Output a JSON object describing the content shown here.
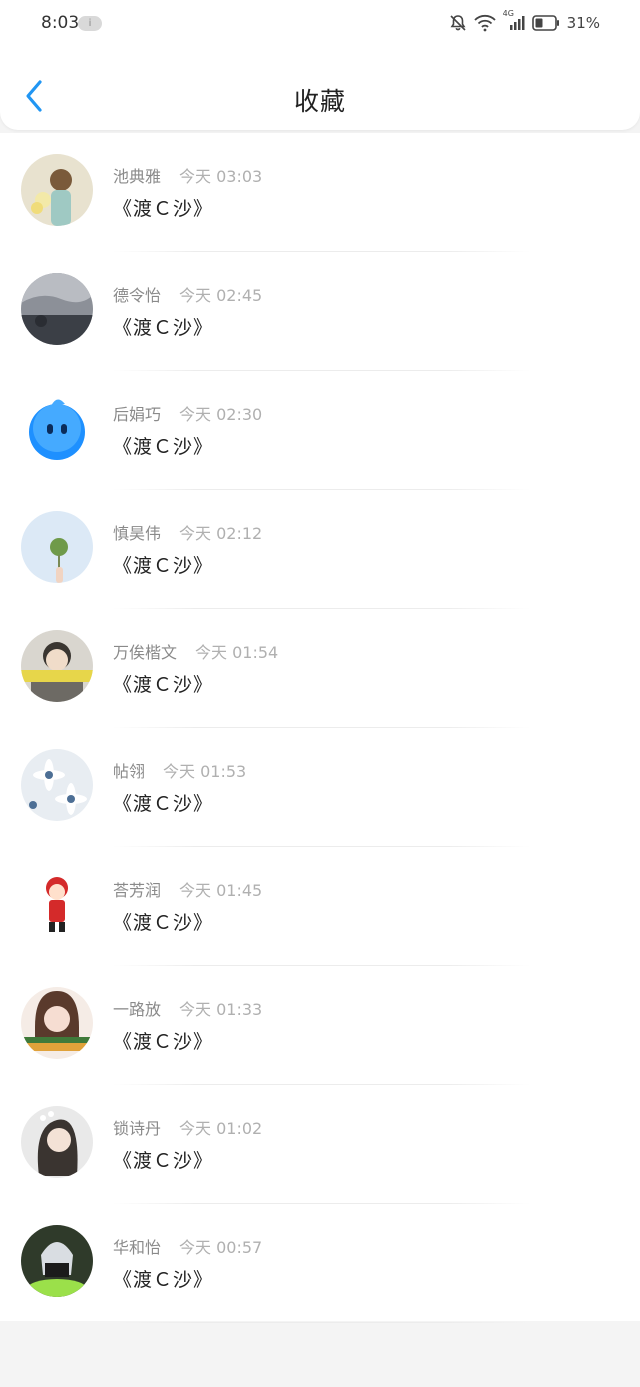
{
  "status_bar": {
    "time": "8:03",
    "pill_label": "i",
    "battery_text": "31%",
    "network_label": "4G",
    "icons": [
      "bell-off-icon",
      "wifi-icon",
      "signal-icon",
      "battery-icon"
    ]
  },
  "header": {
    "title": "收藏",
    "back_icon": "chevron-left-icon"
  },
  "items": [
    {
      "name": "池典雅",
      "time": "今天 03:03",
      "title": "《渡Ｃ沙》",
      "avatar_colors": [
        "#e8e2cf",
        "#c9b58a"
      ]
    },
    {
      "name": "德令怡",
      "time": "今天 02:45",
      "title": "《渡Ｃ沙》",
      "avatar_colors": [
        "#8c9098",
        "#3b3f46"
      ]
    },
    {
      "name": "后娟巧",
      "time": "今天 02:30",
      "title": "《渡Ｃ沙》",
      "avatar_colors": [
        "#ffffff",
        "#1e90ff"
      ]
    },
    {
      "name": "慎昊伟",
      "time": "今天 02:12",
      "title": "《渡Ｃ沙》",
      "avatar_colors": [
        "#dce9f6",
        "#b8cfe8"
      ]
    },
    {
      "name": "万俟楷文",
      "time": "今天 01:54",
      "title": "《渡Ｃ沙》",
      "avatar_colors": [
        "#d9d6cf",
        "#6d6a64"
      ]
    },
    {
      "name": "帖翎",
      "time": "今天 01:53",
      "title": "《渡Ｃ沙》",
      "avatar_colors": [
        "#9aa8b6",
        "#e8edf2"
      ]
    },
    {
      "name": "荅芳润",
      "time": "今天 01:45",
      "title": "《渡Ｃ沙》",
      "avatar_colors": [
        "#ffffff",
        "#d42a2a"
      ]
    },
    {
      "name": "一路放",
      "time": "今天 01:33",
      "title": "《渡Ｃ沙》",
      "avatar_colors": [
        "#f5ece6",
        "#e0a23a"
      ]
    },
    {
      "name": "锁诗丹",
      "time": "今天 01:02",
      "title": "《渡Ｃ沙》",
      "avatar_colors": [
        "#e9e9e9",
        "#3a3430"
      ]
    },
    {
      "name": "华和怡",
      "time": "今天 00:57",
      "title": "《渡Ｃ沙》",
      "avatar_colors": [
        "#2f3a2a",
        "#9be04a"
      ]
    }
  ]
}
